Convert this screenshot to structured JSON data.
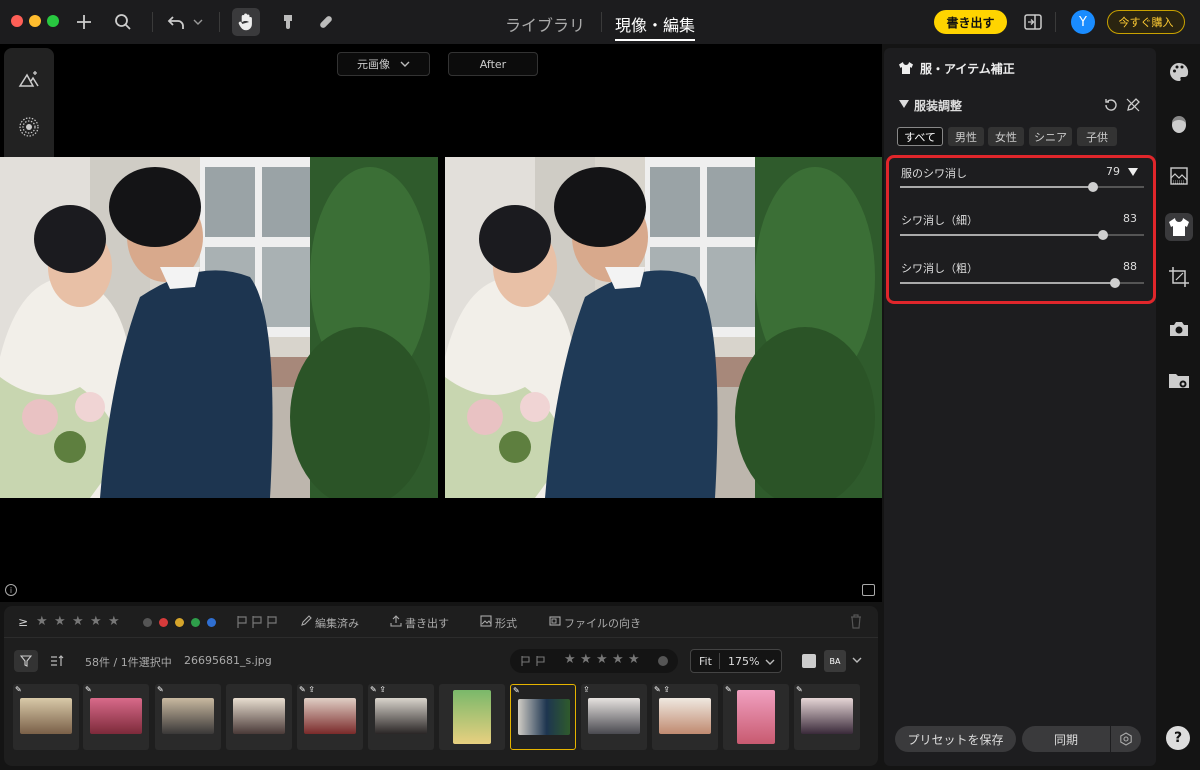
{
  "titlebar": {
    "tabs": [
      {
        "label": "ライブラリ"
      },
      {
        "label": "現像・編集"
      }
    ],
    "export_label": "書き出す",
    "avatar_initial": "Y",
    "buy_label": "今すぐ購入"
  },
  "canvas": {
    "before_select": "元画像",
    "after_label": "After"
  },
  "filmstrip": {
    "filter_items": {
      "gte": "≥",
      "edited": "編集済み",
      "exported": "書き出す",
      "format": "形式",
      "orientation": "ファイルの向き"
    },
    "count_text": "58件 / 1件選択中",
    "filename": "26695681_s.jpg",
    "fit_label": "Fit",
    "zoom_value": "175%",
    "ba_label": "BA",
    "color_dots": [
      "#555555",
      "#d63b3b",
      "#d6a52b",
      "#2e9e4a",
      "#2f6fd1"
    ]
  },
  "panel": {
    "title": "服・アイテム補正",
    "section": "服装調整",
    "chips": [
      {
        "label": "すべて"
      },
      {
        "label": "男性"
      },
      {
        "label": "女性"
      },
      {
        "label": "シニア"
      },
      {
        "label": "子供"
      }
    ],
    "sliders": [
      {
        "label": "服のシワ消し",
        "value": "79",
        "fraction": 0.79
      },
      {
        "label": "シワ消し（細）",
        "value": "83",
        "fraction": 0.83
      },
      {
        "label": "シワ消し（粗）",
        "value": "88",
        "fraction": 0.88
      }
    ],
    "save_preset_label": "プリセットを保存",
    "sync_label": "同期"
  },
  "help_label": "?"
}
